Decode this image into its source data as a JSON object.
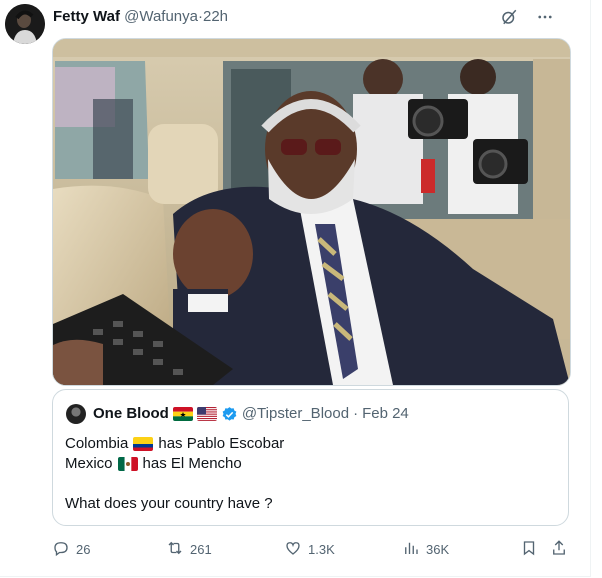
{
  "tweet": {
    "author_name": "Fetty Waf",
    "author_handle": "@Wafunya",
    "separator": "·",
    "timestamp": "22h"
  },
  "quote": {
    "author_name": "One Blood",
    "author_handle": "@Tipster_Blood",
    "separator": "·",
    "timestamp": "Feb 24",
    "lines": [
      {
        "pre": "Colombia",
        "post": "has Pablo Escobar"
      },
      {
        "pre": "Mexico",
        "post": "has El Mencho"
      }
    ],
    "question": "What does your country have ?"
  },
  "actions": {
    "replies": "26",
    "retweets": "261",
    "likes": "1.3K",
    "views": "36K"
  },
  "colors": {
    "text": "#0f1419",
    "muted": "#536471",
    "border": "#cfd9de",
    "verified": "#1d9bf0"
  },
  "icons": [
    "grok-icon",
    "more-icon",
    "reply-icon",
    "retweet-icon",
    "like-icon",
    "views-icon",
    "bookmark-icon",
    "share-icon",
    "verified-badge-icon"
  ]
}
